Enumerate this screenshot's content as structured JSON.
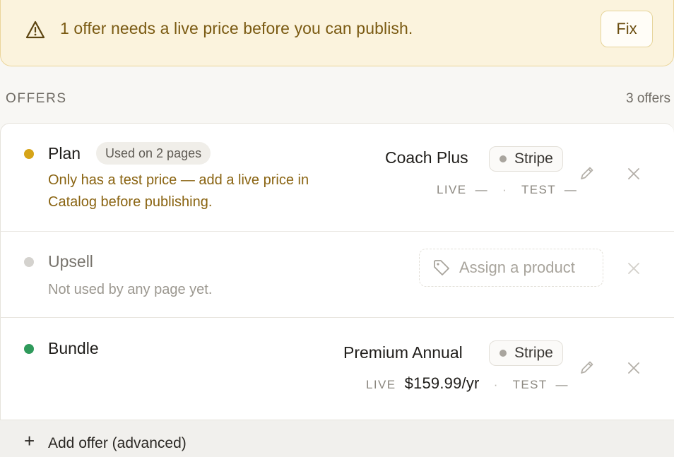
{
  "banner": {
    "icon": "warning-triangle-icon",
    "message": "1 offer needs a live price before you can publish.",
    "fix_label": "Fix"
  },
  "section": {
    "title": "OFFERS",
    "count": "3 offers"
  },
  "offers": [
    {
      "name": "Plan",
      "status_color": "#d6a418",
      "usage_badge": "Used on 2 pages",
      "warning_line_1": "Only has a test price — add a live price in",
      "warning_line_2": "Catalog before publishing.",
      "product": "Coach Plus",
      "provider": "Stripe",
      "live_label": "LIVE",
      "live_value": "—",
      "test_label": "TEST",
      "test_value": "—"
    },
    {
      "name": "Upsell",
      "status_color": "#d4d2ce",
      "note": "Not used by any page yet.",
      "assign_label": "Assign a product"
    },
    {
      "name": "Bundle",
      "status_color": "#2f9a5b",
      "product": "Premium Annual",
      "provider": "Stripe",
      "live_label": "LIVE",
      "live_value": "$159.99/yr",
      "test_label": "TEST",
      "test_value": "—"
    }
  ],
  "footer": {
    "add_label": "Add offer (advanced)",
    "plus": "+"
  },
  "icons": {
    "edit": "pencil-icon",
    "remove": "close-icon",
    "tag": "tag-icon"
  }
}
